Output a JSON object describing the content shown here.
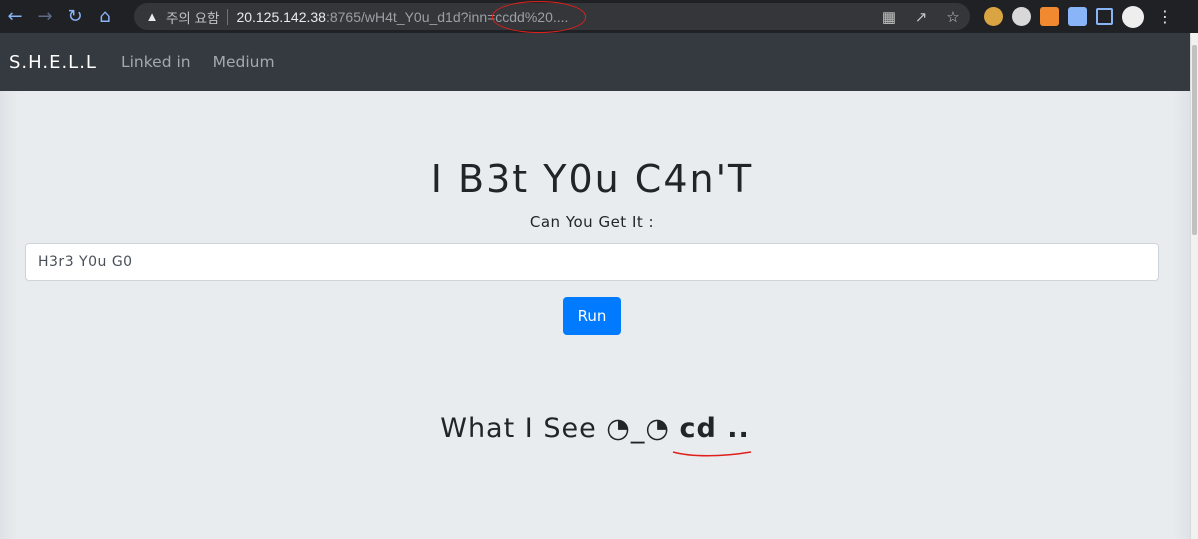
{
  "browser": {
    "security_warning": "주의 요함",
    "url_host": "20.125.142.38",
    "url_path": ":8765/wH4t_Y0u_d1d?inn=ccdd%20...."
  },
  "navbar": {
    "brand": "S.H.E.L.L",
    "links": [
      "Linked in",
      "Medium"
    ]
  },
  "main": {
    "heading": "I B3t Y0u C4n'T",
    "label": "Can You Get It :",
    "input_value": "H3r3 Y0u G0",
    "run_button": "Run",
    "result_prefix": "What I See ◔_◔",
    "result_output": "cd .."
  },
  "colors": {
    "navbar_bg": "#343a40",
    "page_bg": "#e9ecef",
    "button_bg": "#007bff",
    "annotation": "#e0201b"
  },
  "icons": [
    "back-arrow-icon",
    "forward-arrow-icon",
    "reload-icon",
    "home-icon",
    "warning-icon",
    "translate-icon",
    "share-icon",
    "star-icon",
    "extensions-icon",
    "menu-icon"
  ]
}
